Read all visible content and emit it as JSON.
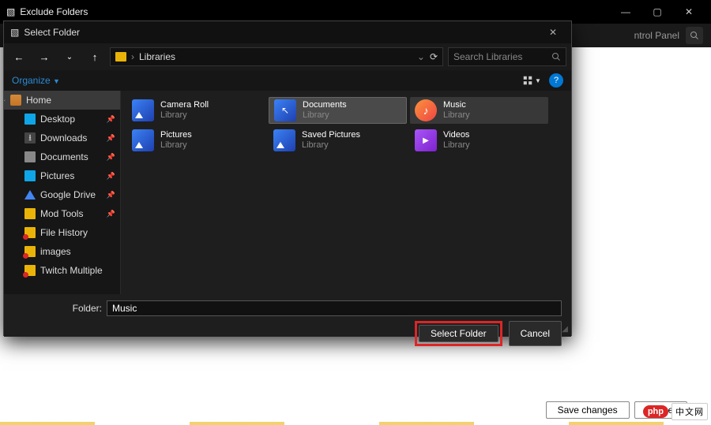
{
  "outer": {
    "title": "Exclude Folders",
    "toolbar_text": "ntrol Panel",
    "save_btn": "Save changes",
    "cancel_btn": "Cancel"
  },
  "dialog": {
    "title": "Select Folder",
    "location": "Libraries",
    "search_placeholder": "Search Libraries",
    "organize": "Organize",
    "folder_label": "Folder:",
    "folder_value": "Music",
    "select_btn": "Select Folder",
    "cancel_btn": "Cancel"
  },
  "sidebar": {
    "items": [
      {
        "label": "Home"
      },
      {
        "label": "Desktop"
      },
      {
        "label": "Downloads"
      },
      {
        "label": "Documents"
      },
      {
        "label": "Pictures"
      },
      {
        "label": "Google Drive"
      },
      {
        "label": "Mod Tools"
      },
      {
        "label": "File History"
      },
      {
        "label": "images"
      },
      {
        "label": "Twitch Multiple"
      }
    ]
  },
  "libraries": [
    {
      "name": "Camera Roll",
      "sub": "Library"
    },
    {
      "name": "Documents",
      "sub": "Library"
    },
    {
      "name": "Music",
      "sub": "Library"
    },
    {
      "name": "Pictures",
      "sub": "Library"
    },
    {
      "name": "Saved Pictures",
      "sub": "Library"
    },
    {
      "name": "Videos",
      "sub": "Library"
    }
  ],
  "brand": {
    "pill": "php",
    "chars": "中文网"
  }
}
